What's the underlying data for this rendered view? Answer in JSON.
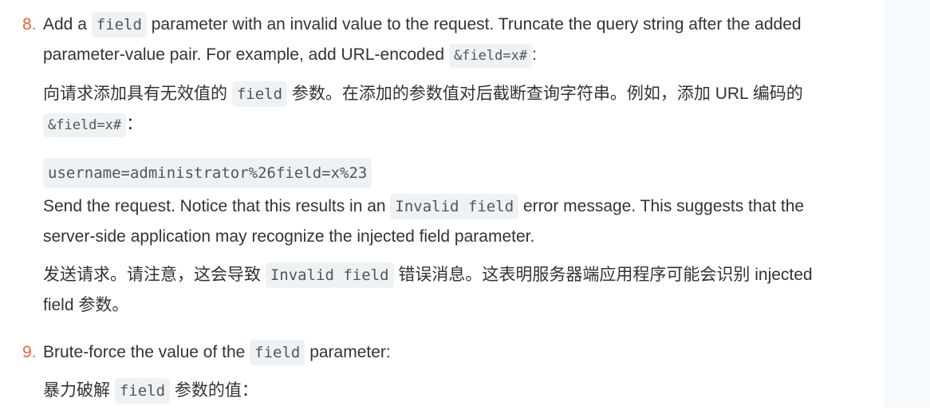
{
  "step8": {
    "number": "8.",
    "en1": {
      "t1": "Add a ",
      "c1": "field",
      "t2": " parameter with an invalid value to the request. Truncate the query string after the added parameter-value pair. For example, add URL-encoded ",
      "c2": "&field=x#",
      "t3": ":"
    },
    "zh1": {
      "t1": "向请求添加具有无效值的 ",
      "c1": "field",
      "t2": " 参数。在添加的参数值对后截断查询字符串。例如，添加 URL 编码的 ",
      "c2": "&field=x#",
      "t3": "："
    },
    "code_block": "username=administrator%26field=x%23",
    "en2": {
      "t1": "Send the request. Notice that this results in an ",
      "c1": "Invalid field",
      "t2": " error message. This suggests that the server-side application may recognize the injected field parameter."
    },
    "zh2": {
      "t1": "发送请求。请注意，这会导致 ",
      "c1": "Invalid field",
      "t2": " 错误消息。这表明服务器端应用程序可能会识别 injected field 参数。"
    }
  },
  "step9": {
    "number": "9.",
    "en": {
      "t1": "Brute-force the value of the ",
      "c1": "field",
      "t2": " parameter:"
    },
    "zh": {
      "t1": "暴力破解 ",
      "c1": "field",
      "t2": " 参数的值："
    }
  }
}
